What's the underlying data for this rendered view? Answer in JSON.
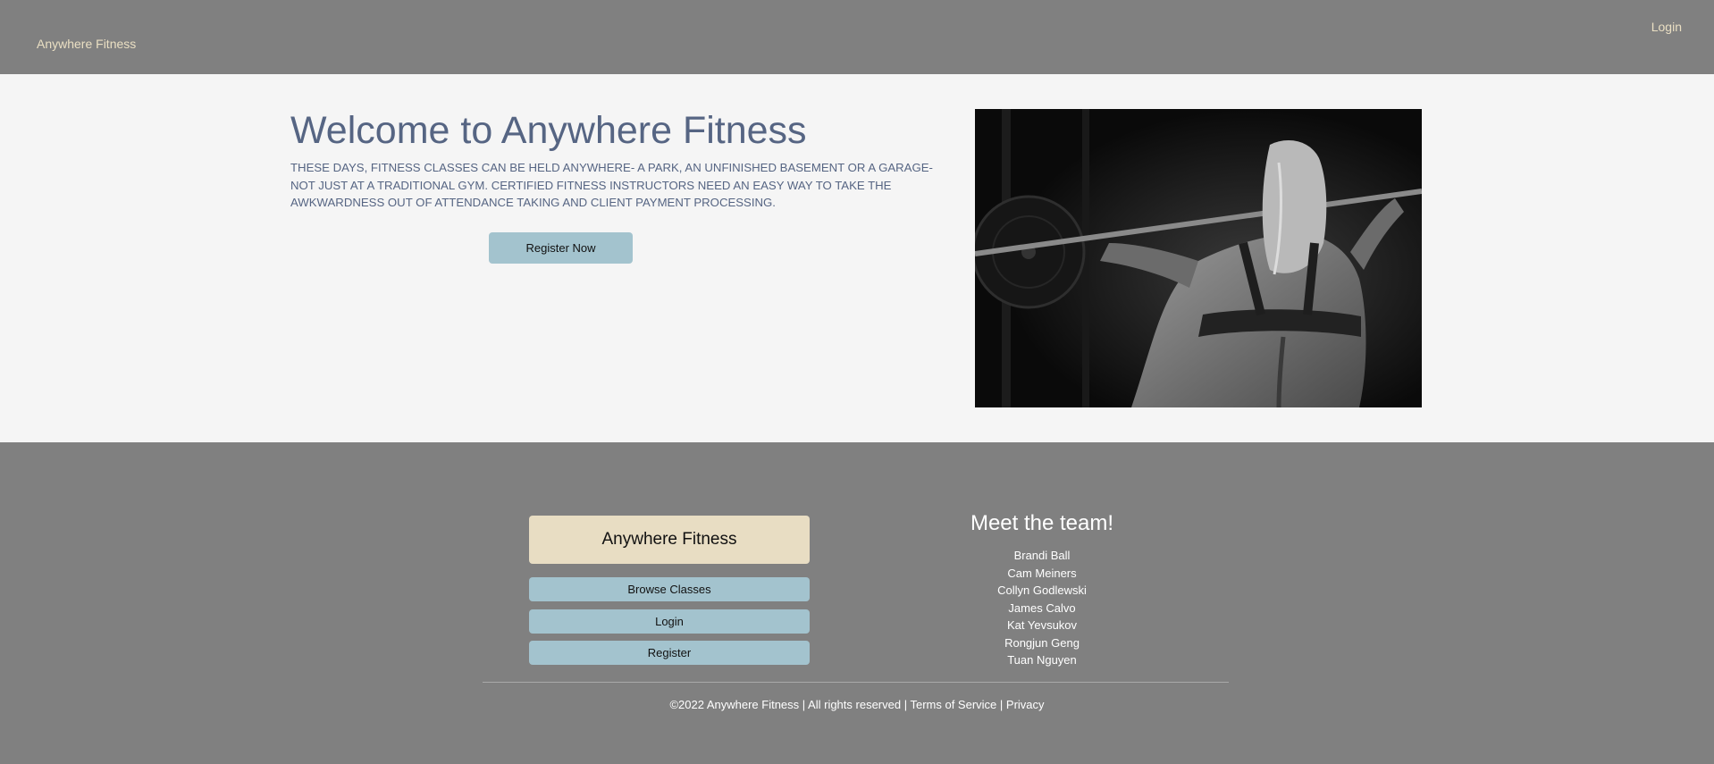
{
  "navbar": {
    "brand": "Anywhere Fitness",
    "login": "Login",
    "link_color": "#eadfc3",
    "background": "#808080"
  },
  "hero": {
    "title": "Welcome to Anywhere Fitness",
    "description": "THESE DAYS, FITNESS CLASSES CAN BE HELD ANYWHERE- A PARK, AN UNFINISHED BASEMENT OR A GARAGE- NOT JUST AT A TRADITIONAL GYM. CERTIFIED FITNESS INSTRUCTORS NEED AN EASY WAY TO TAKE THE AWKWARDNESS OUT OF ATTENDANCE TAKING AND CLIENT PAYMENT PROCESSING.",
    "register_button": "Register Now",
    "text_color": "#566583",
    "button_color": "#a3c3ce",
    "background": "#f5f5f5"
  },
  "footer": {
    "brand_card": "Anywhere Fitness",
    "buttons": [
      "Browse Classes",
      "Login",
      "Register"
    ],
    "team_title": "Meet the team!",
    "team": [
      "Brandi Ball",
      "Cam Meiners",
      "Collyn Godlewski",
      "James Calvo",
      "Kat Yevsukov",
      "Rongjun Geng",
      "Tuan Nguyen"
    ],
    "copyright": "©2022 Anywhere Fitness | All rights reserved |",
    "terms": "Terms of Service",
    "separator": "|",
    "privacy": "Privacy",
    "card_color": "#e8ddc3",
    "background": "#808080"
  }
}
